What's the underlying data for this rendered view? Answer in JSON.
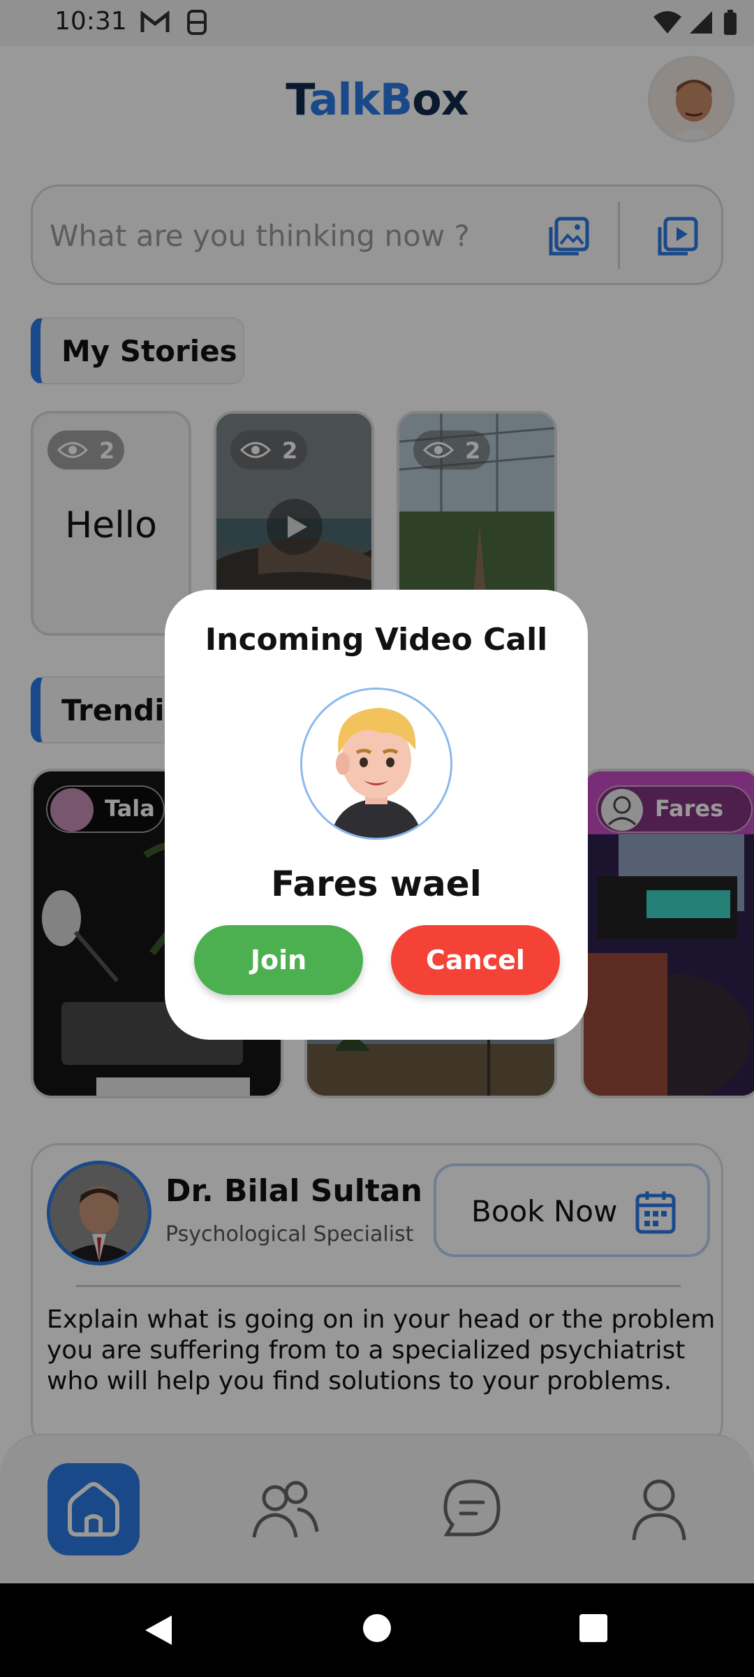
{
  "status_bar": {
    "time": "10:31"
  },
  "app": {
    "title_part1": "T",
    "title_part2": "alk",
    "title_part3": "B",
    "title_part4": "ox"
  },
  "composer": {
    "placeholder": "What are you thinking now ?"
  },
  "stories": {
    "title": "My Stories",
    "items": [
      {
        "views": "2",
        "text": "Hello"
      },
      {
        "views": "2",
        "text": ""
      },
      {
        "views": "2",
        "text": ""
      }
    ]
  },
  "trending": {
    "title": "Trending",
    "items": [
      {
        "user": "Tala"
      },
      {
        "user": ""
      },
      {
        "user": "Fares"
      }
    ]
  },
  "doctor": {
    "name": "Dr. Bilal Sultan",
    "role": "Psychological Specialist",
    "book_label": "Book Now",
    "description": "Explain what is going on in your head or the problem you are suffering from to a specialized psychiatrist who will help you find solutions to your problems."
  },
  "dialog": {
    "title": "Incoming Video Call",
    "caller": "Fares wael",
    "join_label": "Join",
    "cancel_label": "Cancel"
  },
  "colors": {
    "brand_dark": "#0f2c4f",
    "brand_blue": "#2c7be5",
    "join": "#4caf50",
    "cancel": "#f44336"
  }
}
